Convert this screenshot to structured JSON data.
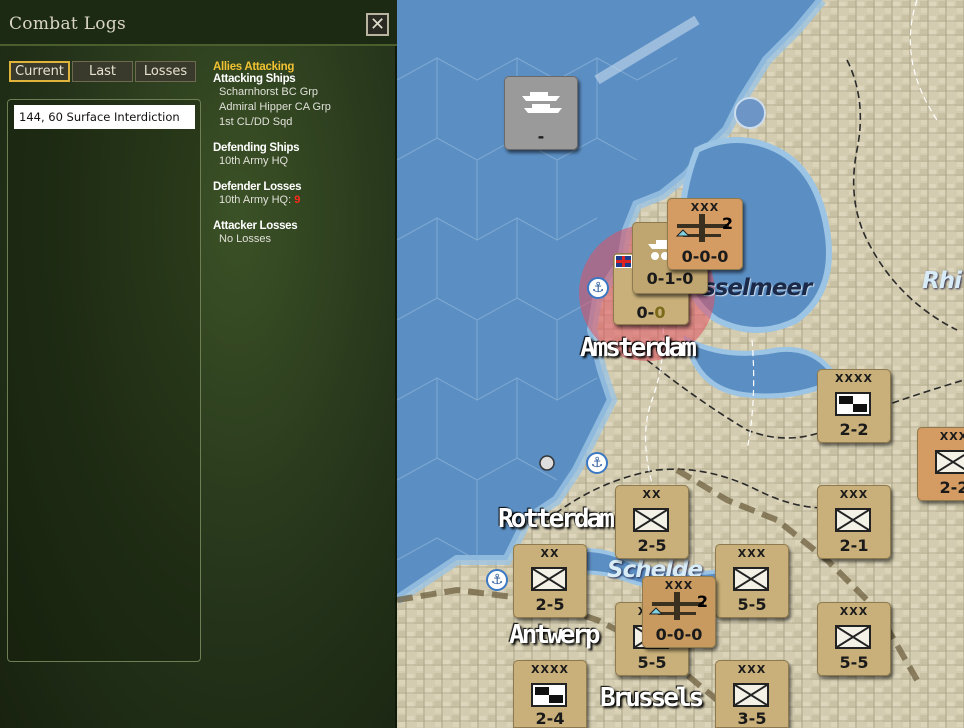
{
  "panel": {
    "title": "Combat Logs",
    "close_symbol": "✕",
    "tabs": [
      {
        "label": "Current",
        "selected": true
      },
      {
        "label": "Last",
        "selected": false
      },
      {
        "label": "Losses",
        "selected": false
      }
    ],
    "log_entries": [
      "144, 60 Surface Interdiction"
    ],
    "detail": {
      "attacker_side": "Allies Attacking",
      "attacking_ships_label": "Attacking Ships",
      "attacking_ships": [
        "Scharnhorst BC Grp",
        "Admiral Hipper CA Grp",
        "1st CL/DD Sqd"
      ],
      "defending_ships_label": "Defending Ships",
      "defending_ships": [
        "10th Army HQ"
      ],
      "defender_losses_label": "Defender Losses",
      "defender_loss_unit": "10th Army HQ:",
      "defender_loss_value": "9",
      "attacker_losses_label": "Attacker Losses",
      "attacker_losses": "No Losses"
    }
  },
  "map": {
    "cities": [
      "Amsterdam",
      "Rotterdam",
      "Antwerp",
      "Brussels"
    ],
    "water_labels": [
      "sselmeer",
      "Schelde",
      "Rhi"
    ],
    "naval_counter": {
      "strength": "-"
    },
    "air_counter_top": {
      "size": "XXX",
      "count": "2",
      "strength": "0-0-0"
    },
    "stack_counter": {
      "strength": "0-1-0",
      "strength_lower_a": "0-",
      "strength_lower_b": "0"
    },
    "air_counter_bottom": {
      "size": "XXX",
      "count": "2",
      "strength": "0-0-0"
    },
    "units": [
      {
        "size": "XXXX",
        "strength": "2-2",
        "type": "armor"
      },
      {
        "size": "XXX",
        "strength": "2-2",
        "type": "infantry"
      },
      {
        "size": "XX",
        "strength": "2-5",
        "type": "infantry"
      },
      {
        "size": "XXX",
        "strength": "2-1",
        "type": "infantry"
      },
      {
        "size": "XX",
        "strength": "2-5",
        "type": "infantry"
      },
      {
        "size": "XXX",
        "strength": "5-5",
        "type": "infantry"
      },
      {
        "size": "XXX",
        "strength": "5-5",
        "type": "infantry"
      },
      {
        "size": "XXX",
        "strength": "5-5",
        "type": "infantry"
      },
      {
        "size": "XXXX",
        "strength": "2-4",
        "type": "armor"
      },
      {
        "size": "XXX",
        "strength": "3-5",
        "type": "infantry"
      }
    ],
    "colors": {
      "sea": "#5b8fc4",
      "land": "#d6cfb4",
      "counter": "#c9b07a",
      "highlight": "#e05060"
    }
  }
}
